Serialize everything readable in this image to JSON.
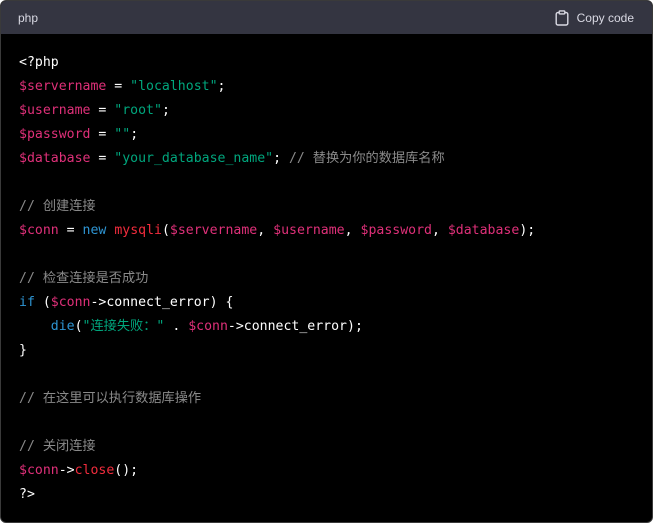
{
  "header": {
    "language": "php",
    "copy_label": "Copy code",
    "copy_icon": "clipboard-icon"
  },
  "colors": {
    "variable": "#df3079",
    "string": "#00a67d",
    "keyword": "#2e95d3",
    "function": "#f22c3d",
    "comment": "#8a8a8a",
    "plain": "#ffffff",
    "header_bg": "#343541",
    "code_bg": "#000000"
  },
  "code": {
    "l1": {
      "open_tag": "<?php"
    },
    "l2": {
      "var": "$servername",
      "op": " = ",
      "str": "\"localhost\"",
      "end": ";"
    },
    "l3": {
      "var": "$username",
      "op": " = ",
      "str": "\"root\"",
      "end": ";"
    },
    "l4": {
      "var": "$password",
      "op": " = ",
      "str": "\"\"",
      "end": ";"
    },
    "l5": {
      "var": "$database",
      "op": " = ",
      "str": "\"your_database_name\"",
      "end": "; ",
      "comment": "// 替换为你的数据库名称"
    },
    "l7": {
      "comment": "// 创建连接"
    },
    "l8": {
      "var": "$conn",
      "op": " = ",
      "kw": "new",
      "sp": " ",
      "fn": "mysqli",
      "p1": "(",
      "a1": "$servername",
      "c1": ", ",
      "a2": "$username",
      "c2": ", ",
      "a3": "$password",
      "c3": ", ",
      "a4": "$database",
      "end": ");"
    },
    "l10": {
      "comment": "// 检查连接是否成功"
    },
    "l11": {
      "kw": "if",
      "p1": " (",
      "var": "$conn",
      "rest": "->connect_error) {"
    },
    "l12": {
      "indent": "    ",
      "fn": "die",
      "p1": "(",
      "str": "\"连接失败：\"",
      "dot": " . ",
      "var": "$conn",
      "rest": "->connect_error);"
    },
    "l13": {
      "brace": "}"
    },
    "l15": {
      "comment": "// 在这里可以执行数据库操作"
    },
    "l17": {
      "comment": "// 关闭连接"
    },
    "l18": {
      "var": "$conn",
      "arrow": "->",
      "fn": "close",
      "end": "();"
    },
    "l19": {
      "close_tag": "?>"
    }
  }
}
